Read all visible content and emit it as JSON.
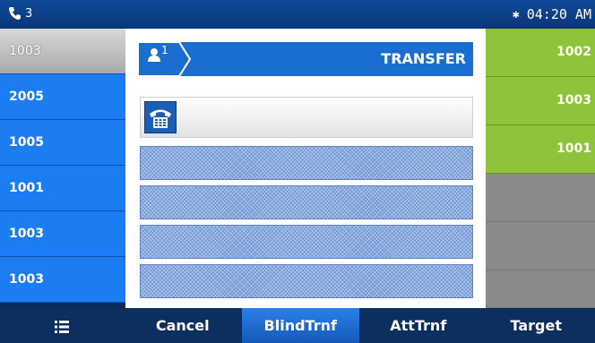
{
  "status": {
    "call_count": "3",
    "time": "04:20 AM"
  },
  "left_lines": [
    "1003",
    "2005",
    "1005",
    "1001",
    "1003",
    "1003"
  ],
  "right_lines": [
    "1002",
    "1003",
    "1001",
    "",
    "",
    ""
  ],
  "dialog": {
    "title": "TRANSFER",
    "account_index": "1"
  },
  "softkeys": {
    "cancel": "Cancel",
    "blind": "BlindTrnf",
    "att": "AttTrnf",
    "target": "Target"
  }
}
